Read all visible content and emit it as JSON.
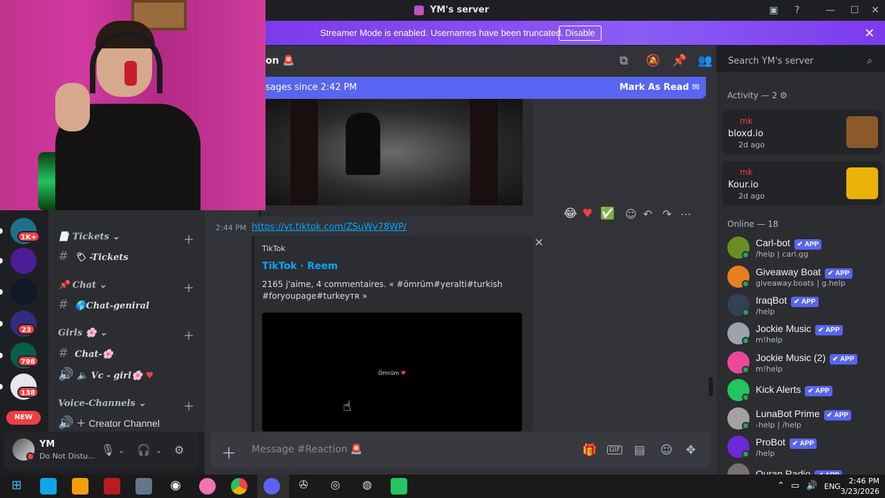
{
  "window": {
    "title": "YM's server"
  },
  "banner": {
    "text": "Streamer Mode is enabled. Usernames have been truncated.",
    "button": "Disable"
  },
  "servers": [
    {
      "badge": "1K+",
      "color": "#1f6f8b"
    },
    {
      "badge": "",
      "color": "#4c1d95"
    },
    {
      "badge": "",
      "color": "#111827"
    },
    {
      "badge": "23",
      "color": "#312e81"
    },
    {
      "badge": "798",
      "color": "#065f46"
    },
    {
      "badge": "138",
      "color": "#e5e7eb"
    }
  ],
  "new_badge": "NEW",
  "channels": {
    "cat_tickets": "Tickets",
    "ch_tickets": "-Tickets",
    "cat_chat": "Chat",
    "ch_chat": "Chat-geniral",
    "cat_girls": "Girls",
    "ch_girls_text": "Chat-",
    "ch_girls_vc": "Vc - girl",
    "cat_voice": "Voice-Channels",
    "ch_creator": "Creator Channel"
  },
  "user": {
    "name": "YM",
    "status": "Do Not Distu..."
  },
  "chat": {
    "header_name": "on",
    "new_messages": "sages since 2:42 PM",
    "mark_read": "Mark As Read",
    "time": "2:44 PM",
    "link": "https://vt.tiktok.com/ZSuWv78WP/",
    "embed_provider": "TikTok",
    "embed_title": "TikTok · Reem",
    "embed_desc": "2165 j'aime, 4 commentaires. « #ömrüm#yeralti#turkish #foryoupage#turkeyᴛʀ »",
    "embed_caption": "Ömrüm",
    "composer_placeholder": "Message #Reaction"
  },
  "search": {
    "placeholder": "Search YM's server"
  },
  "activity": {
    "heading": "Activity — 2",
    "cards": [
      {
        "user": "mk",
        "game": "bloxd.io",
        "time": "2d ago",
        "color": "#8b5a2b"
      },
      {
        "user": "mk",
        "game": "Kour.io",
        "time": "2d ago",
        "color": "#eab308"
      }
    ]
  },
  "online": {
    "heading": "Online — 18",
    "members": [
      {
        "name": "Carl-bot",
        "sub": "/help | carl.gg",
        "app": "APP",
        "color": "#6b8e23"
      },
      {
        "name": "Giveaway Boat",
        "sub": "giveaway.boats | g.help",
        "app": "APP",
        "color": "#e67e22"
      },
      {
        "name": "IraqBot",
        "sub": "/help",
        "app": "APP",
        "color": "#334155"
      },
      {
        "name": "Jockie Music",
        "sub": "m!help",
        "app": "APP",
        "color": "#9ca3af"
      },
      {
        "name": "Jockie Music (2)",
        "sub": "m!help",
        "app": "APP",
        "color": "#ec4899"
      },
      {
        "name": "Kick Alerts",
        "sub": "",
        "app": "APP",
        "color": "#22c55e"
      },
      {
        "name": "LunaBot Prime",
        "sub": "-help | /help",
        "app": "APP",
        "color": "#a3a3a3"
      },
      {
        "name": "ProBot",
        "sub": "/help",
        "app": "APP",
        "color": "#6d28d9"
      },
      {
        "name": "Quran Radio",
        "sub": "",
        "app": "APP",
        "color": "#78716c"
      }
    ]
  },
  "taskbar": {
    "time": "2:46 PM",
    "date": "3/23/2026",
    "lang": "ENG"
  }
}
